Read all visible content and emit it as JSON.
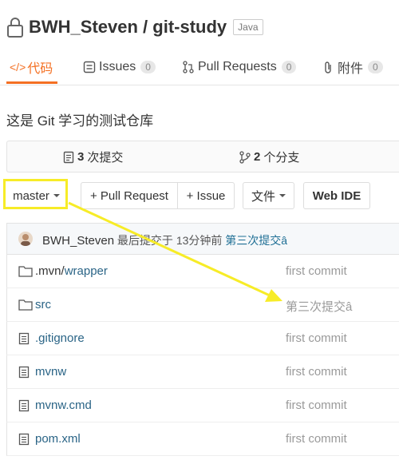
{
  "repo": {
    "owner": "BWH_Steven",
    "separator": " / ",
    "name": "git-study",
    "language": "Java"
  },
  "tabs": [
    {
      "label": "代码",
      "icon": "code-icon",
      "count": ""
    },
    {
      "label": "Issues",
      "icon": "issues-icon",
      "count": "0"
    },
    {
      "label": "Pull Requests",
      "icon": "pull-request-icon",
      "count": "0"
    },
    {
      "label": "附件",
      "icon": "attachment-icon",
      "count": "0"
    }
  ],
  "description": "这是 Git 学习的测试仓库",
  "stats": {
    "commits_count": "3",
    "commits_label": "次提交",
    "branches_count": "2",
    "branches_label": "个分支"
  },
  "toolbar": {
    "branch": "master",
    "pull_request": "+ Pull Request",
    "issue": "+ Issue",
    "files": "文件",
    "web_ide": "Web IDE"
  },
  "last_commit": {
    "author": "BWH_Steven",
    "info": " 最后提交于 13分钟前 ",
    "message": "第三次提交â"
  },
  "files": [
    {
      "type": "folder",
      "name_prefix": ".mvn/",
      "name": "wrapper",
      "commit": "first commit"
    },
    {
      "type": "folder",
      "name_prefix": "",
      "name": "src",
      "commit": "第三次提交â"
    },
    {
      "type": "file",
      "name_prefix": "",
      "name": ".gitignore",
      "commit": "first commit"
    },
    {
      "type": "file",
      "name_prefix": "",
      "name": "mvnw",
      "commit": "first commit"
    },
    {
      "type": "file",
      "name_prefix": "",
      "name": "mvnw.cmd",
      "commit": "first commit"
    },
    {
      "type": "file",
      "name_prefix": "",
      "name": "pom.xml",
      "commit": "first commit"
    }
  ],
  "colors": {
    "accent": "#f47023",
    "annotation": "#f7ec27",
    "link": "#2a6486"
  }
}
